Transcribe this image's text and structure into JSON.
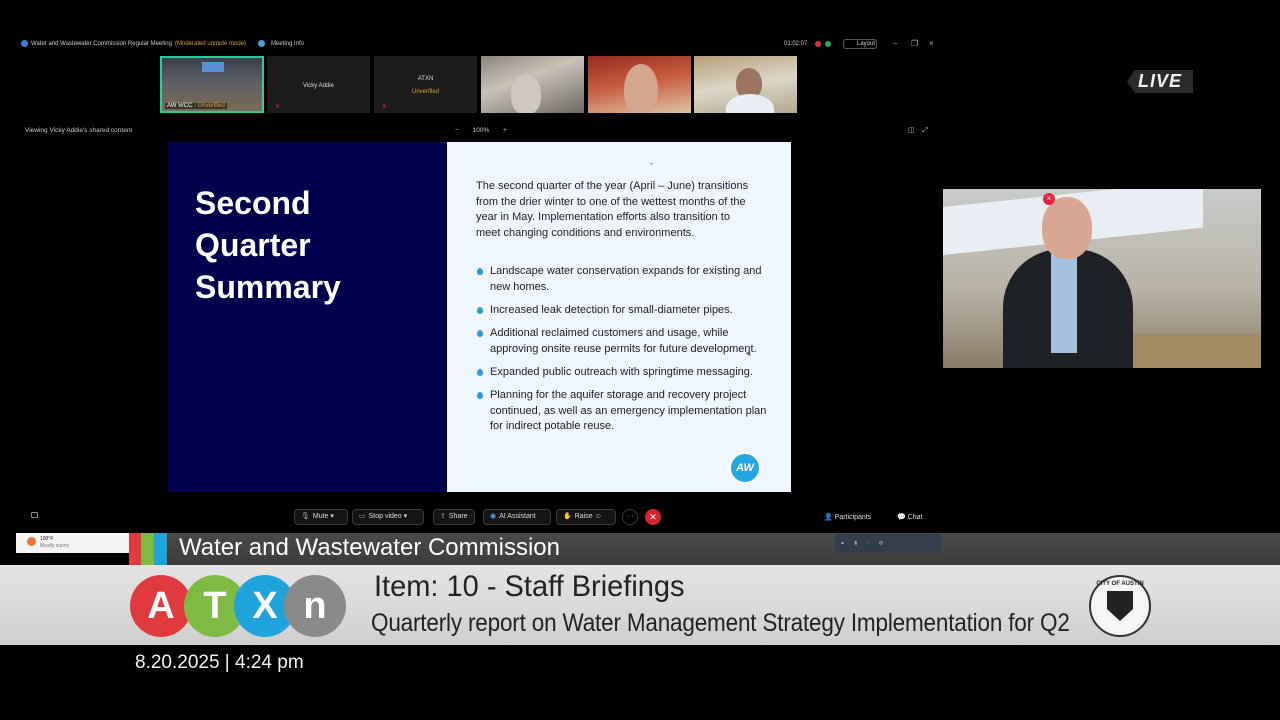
{
  "meeting": {
    "title": "Water and Wastewater Commission Regular Meeting",
    "mode": "(Moderated unmute mode)",
    "info": "Meeting Info",
    "timer": "01:02:07",
    "layout_label": "Layout"
  },
  "participants": [
    {
      "name": "AW WCC",
      "status": "Unverified",
      "active": true
    },
    {
      "name": "Vicky Addie",
      "status": ""
    },
    {
      "name": "ATXN",
      "status": "Unverified"
    },
    {
      "name": "",
      "status": ""
    },
    {
      "name": "",
      "status": ""
    },
    {
      "name": "",
      "status": ""
    }
  ],
  "viewing_text": "Viewing Vicky Addie's shared content",
  "zoom": {
    "minus": "−",
    "value": "100%",
    "plus": "+"
  },
  "slide": {
    "title": "Second Quarter Summary",
    "intro": "The second quarter of the year (April – June) transitions from the drier winter to one of the wettest months of the year in May. Implementation efforts also transition to meet changing conditions and environments.",
    "bullets": [
      "Landscape water conservation expands for existing and new homes.",
      "Increased leak detection for small-diameter pipes.",
      "Additional reclaimed customers and usage, while approving onsite reuse permits for future development.",
      "Expanded public outreach with springtime messaging.",
      "Planning for the aquifer storage and recovery project continued, as well as an emergency implementation plan for indirect potable reuse."
    ],
    "logo_text": "AW"
  },
  "live_badge": "LIVE",
  "controls": {
    "mute": "Mute",
    "stop_video": "Stop video",
    "share": "Share",
    "ai_assistant": "AI Assistant",
    "raise": "Raise",
    "participants": "Participants",
    "chat": "Chat"
  },
  "taskbar": {
    "temp": "100°F",
    "desc": "Mostly sunny"
  },
  "broadcast": {
    "band_title": "Water and Wastewater Commission",
    "item_title": "Item: 10 - Staff Briefings",
    "item_sub": "Quarterly report on Water Management Strategy Implementation for Q2",
    "logo_letters": [
      "A",
      "T",
      "X",
      "n"
    ],
    "logo_colors": [
      "#e03a3e",
      "#7dbb42",
      "#1fa3dd",
      "#8a8a8a"
    ],
    "seal_text": "CITY OF AUSTIN",
    "timestamp": "8.20.2025 | 4:24 pm"
  }
}
